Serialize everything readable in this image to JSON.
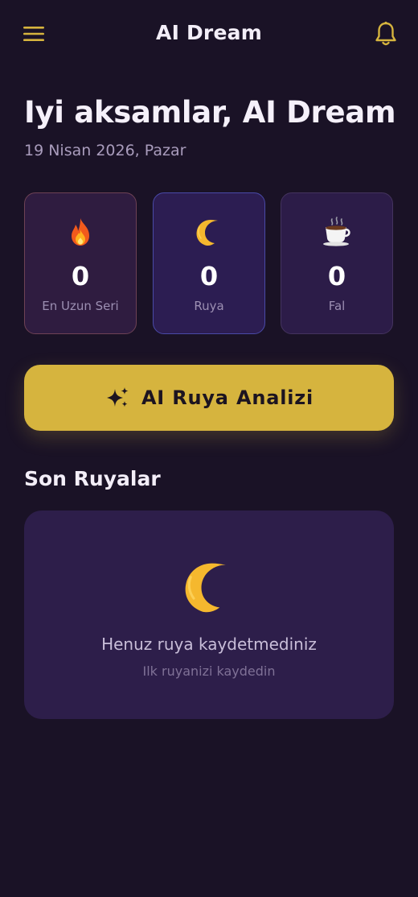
{
  "app_bar": {
    "title": "AI Dream",
    "menu_icon": "hamburger-menu-icon",
    "notification_icon": "bell-icon"
  },
  "greeting": {
    "title": "Iyi aksamlar, AI Dream",
    "date": "19 Nisan 2026, Pazar"
  },
  "stats": [
    {
      "icon": "fire-icon",
      "value": "0",
      "label": "En Uzun Seri"
    },
    {
      "icon": "crescent-moon-icon",
      "value": "0",
      "label": "Ruya"
    },
    {
      "icon": "coffee-cup-icon",
      "value": "0",
      "label": "Fal"
    }
  ],
  "primary_action": {
    "label": "AI Ruya Analizi",
    "icon": "sparkles-icon"
  },
  "recent_dreams": {
    "title": "Son Ruyalar",
    "empty_icon": "crescent-moon-icon",
    "empty_title": "Henuz ruya kaydetmediniz",
    "empty_subtitle": "Ilk ruyanizi kaydedin"
  },
  "colors": {
    "background": "#1a1226",
    "card": "#2d1e4a",
    "accent_gold": "#d6b43e",
    "muted_text": "#a99cbc"
  }
}
